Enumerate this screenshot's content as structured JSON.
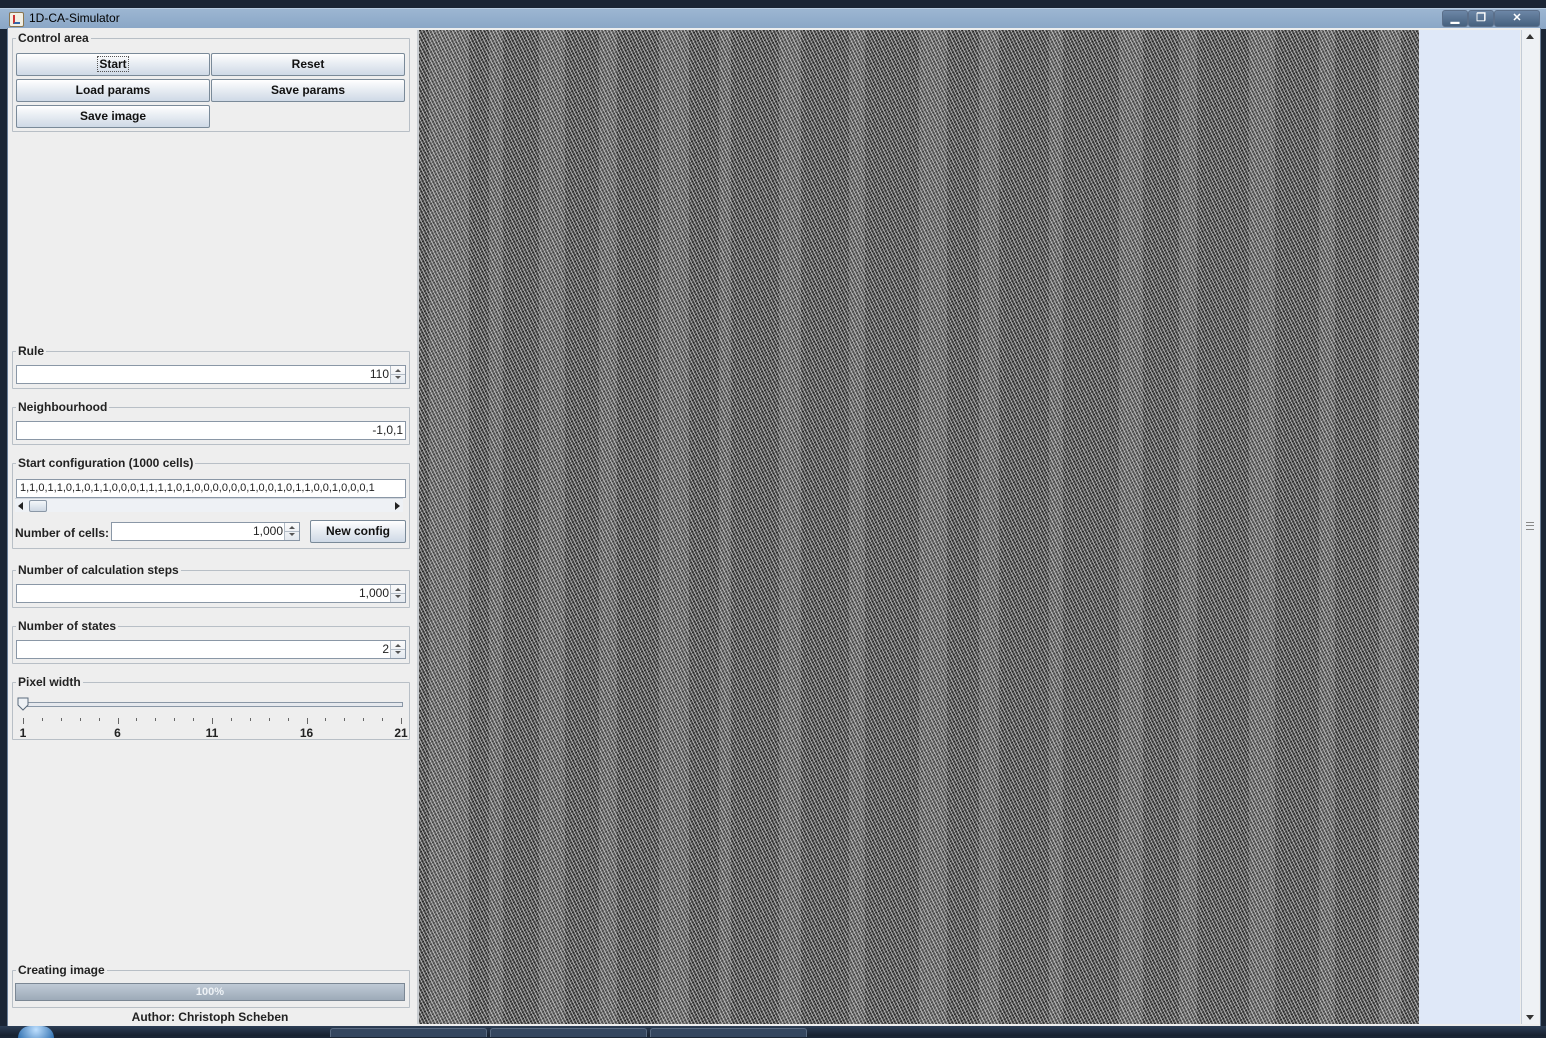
{
  "window": {
    "title": "1D-CA-Simulator",
    "min_glyph": "▁",
    "max_glyph": "❐",
    "close_glyph": "✕"
  },
  "control_area": {
    "legend": "Control area",
    "start_label": "Start",
    "reset_label": "Reset",
    "load_params_label": "Load params",
    "save_params_label": "Save params",
    "save_image_label": "Save image"
  },
  "rule": {
    "legend": "Rule",
    "value": "110"
  },
  "neighbourhood": {
    "legend": "Neighbourhood",
    "value": "-1,0,1"
  },
  "start_config": {
    "legend": "Start configuration (1000 cells)",
    "value": "1,1,0,1,1,0,1,0,1,1,0,0,0,1,1,1,1,0,1,0,0,0,0,0,0,1,0,0,1,0,1,1,0,0,1,0,0,0,1",
    "cells_label": "Number of cells:",
    "cells_value": "1,000",
    "new_config_label": "New config"
  },
  "calc_steps": {
    "legend": "Number of calculation steps",
    "value": "1,000"
  },
  "states": {
    "legend": "Number of states",
    "value": "2"
  },
  "pixel_width": {
    "legend": "Pixel width",
    "min": 1,
    "max": 21,
    "value": 1,
    "tick_labels": [
      "1",
      "6",
      "11",
      "16",
      "21"
    ]
  },
  "creating_image": {
    "legend": "Creating image",
    "progress_text": "100%",
    "progress": 1.0
  },
  "author": "Author: Christoph Scheben"
}
